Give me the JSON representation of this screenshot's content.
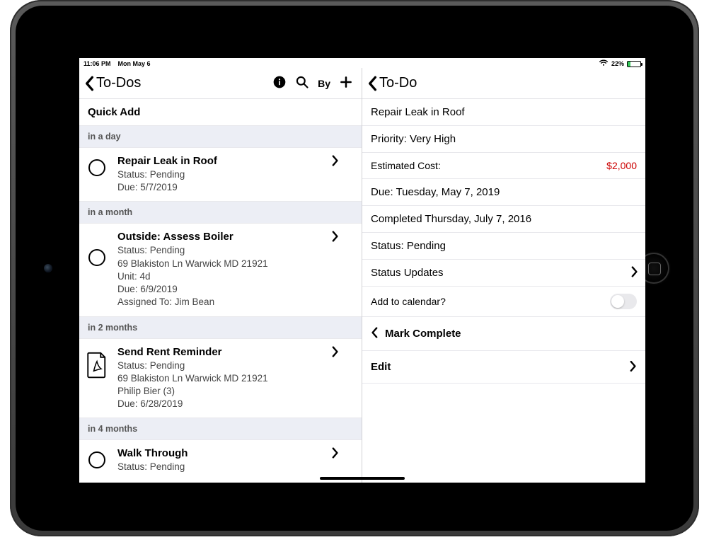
{
  "statusbar": {
    "time": "11:06 PM",
    "date": "Mon May 6",
    "battery_pct": "22%"
  },
  "left": {
    "back_title": "To-Dos",
    "by_label": "By",
    "quick_add": "Quick Add",
    "sections": [
      {
        "label": "in a day"
      },
      {
        "label": "in a month"
      },
      {
        "label": "in 2 months"
      },
      {
        "label": "in 4 months"
      }
    ],
    "tasks": [
      {
        "title": "Repair Leak in Roof",
        "status": "Status: Pending",
        "due": "Due: 5/7/2019"
      },
      {
        "title": "Outside: Assess Boiler",
        "status": "Status: Pending",
        "address": "69 Blakiston Ln Warwick MD 21921",
        "unit": "Unit: 4d",
        "due": "Due: 6/9/2019",
        "assigned": "Assigned To: Jim Bean"
      },
      {
        "title": "Send Rent Reminder",
        "status": "Status: Pending",
        "address": "69 Blakiston Ln Warwick MD 21921",
        "person": "Philip Bier (3)",
        "due": "Due: 6/28/2019"
      },
      {
        "title": "Walk Through",
        "status": "Status: Pending"
      }
    ]
  },
  "right": {
    "back_title": "To-Do",
    "title": "Repair Leak in Roof",
    "priority": "Priority: Very High",
    "estimated_label": "Estimated Cost:",
    "estimated_value": "$2,000",
    "due": "Due: Tuesday, May 7, 2019",
    "completed": "Completed Thursday, July 7, 2016",
    "status": "Status: Pending",
    "status_updates": "Status Updates",
    "add_calendar": "Add to calendar?",
    "mark_complete": "Mark Complete",
    "edit": "Edit"
  }
}
